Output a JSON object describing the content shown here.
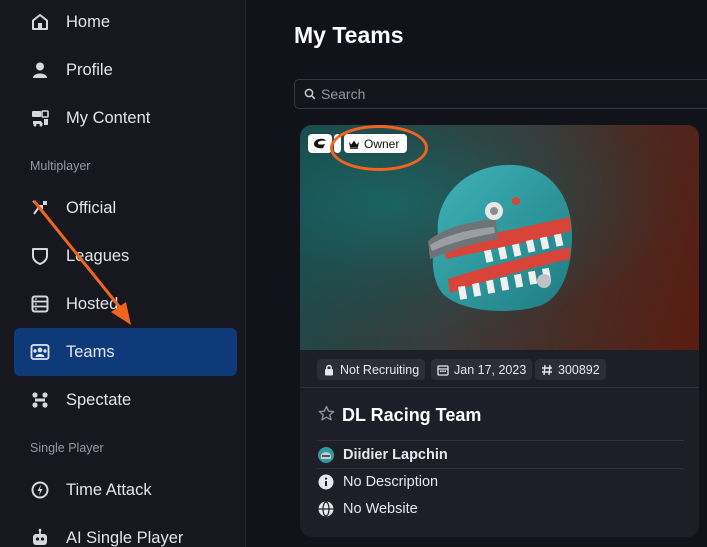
{
  "sidebar": {
    "items": [
      {
        "label": "Home",
        "icon": "home-icon"
      },
      {
        "label": "Profile",
        "icon": "profile-icon"
      },
      {
        "label": "My Content",
        "icon": "content-icon"
      },
      {
        "label": "Official",
        "icon": "checkered-flag-icon"
      },
      {
        "label": "Leagues",
        "icon": "shield-icon"
      },
      {
        "label": "Hosted",
        "icon": "server-icon"
      },
      {
        "label": "Teams",
        "icon": "teams-icon",
        "active": true
      },
      {
        "label": "Spectate",
        "icon": "spectate-icon"
      },
      {
        "label": "Time Attack",
        "icon": "stopwatch-icon"
      },
      {
        "label": "AI Single Player",
        "icon": "robot-icon"
      }
    ],
    "sections": {
      "multiplayer": "Multiplayer",
      "single_player": "Single Player"
    }
  },
  "main": {
    "title": "My Teams",
    "search": {
      "placeholder": "Search",
      "value": ""
    },
    "team_card": {
      "owner_badge": "Owner",
      "tags": {
        "recruiting": "Not Recruiting",
        "date": "Jan 17, 2023",
        "id": "300892"
      },
      "name": "DL Racing Team",
      "member": "Diidier Lapchin",
      "description": "No Description",
      "website": "No Website"
    }
  },
  "colors": {
    "accent_active": "#0e3a7a",
    "annotation": "#f0641e",
    "background": "#12131a"
  }
}
